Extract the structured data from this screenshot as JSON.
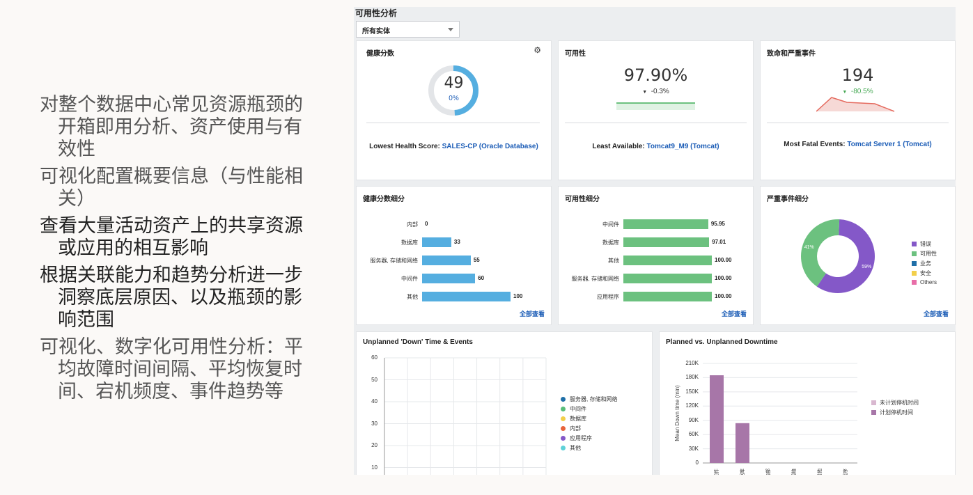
{
  "bullets": [
    {
      "text": "对整个数据中心常见资源瓶颈的开箱即用分析、资产使用与有效性",
      "dark": false
    },
    {
      "text": "可视化配置概要信息（与性能相关）",
      "dark": false
    },
    {
      "text": "查看大量活动资产上的共享资源或应用的相互影响",
      "dark": true
    },
    {
      "text": "根据关联能力和趋势分析进一步洞察底层原因、以及瓶颈的影响范围",
      "dark": true
    },
    {
      "text": "可视化、数字化可用性分析：平均故障时间间隔、平均恢复时间、宕机频度、事件趋势等",
      "dark": false
    }
  ],
  "dashboard": {
    "title": "可用性分析",
    "selector": "所有实体",
    "health": {
      "title": "健康分数",
      "value": "49",
      "percent": "0%",
      "score_fraction": 0.49,
      "footer_label": "Lowest Health Score: ",
      "footer_link": "SALES-CP (Oracle Database)"
    },
    "availability": {
      "title": "可用性",
      "value": "97.90%",
      "delta": "-0.3%",
      "footer_label": "Least Available: ",
      "footer_link": "Tomcat9_M9 (Tomcat)"
    },
    "fatal": {
      "title": "致命和严重事件",
      "value": "194",
      "delta": "-80.5%",
      "footer_label": "Most Fatal Events: ",
      "footer_link": "Tomcat Server 1 (Tomcat)"
    },
    "view_all": "全部查看",
    "unplanned_title": "Unplanned 'Down' Time & Events",
    "planned_title": "Planned vs. Unplanned Downtime"
  },
  "chart_data": [
    {
      "type": "bar",
      "title": "健康分数细分",
      "orientation": "horizontal",
      "categories": [
        "内部",
        "数据库",
        "服务器, 存储和网络",
        "中间件",
        "其他"
      ],
      "values": [
        0,
        33,
        55,
        60,
        100
      ],
      "value_labels": [
        "0",
        "33",
        "55",
        "60",
        "100"
      ],
      "xlim": [
        0,
        100
      ],
      "color": "#55aee0"
    },
    {
      "type": "bar",
      "title": "可用性细分",
      "orientation": "horizontal",
      "categories": [
        "中间件",
        "数据库",
        "其他",
        "服务器, 存储和网络",
        "应用程序"
      ],
      "values": [
        95.95,
        97.01,
        100.0,
        100.0,
        100.0
      ],
      "value_labels": [
        "95.95",
        "97.01",
        "100.00",
        "100.00",
        "100.00"
      ],
      "xlim": [
        0,
        100
      ],
      "color": "#6cc17f"
    },
    {
      "type": "pie",
      "title": "严重事件细分",
      "slices": [
        {
          "name": "错误",
          "value": 59,
          "label": "59%",
          "color": "#8458c8"
        },
        {
          "name": "可用性",
          "value": 41,
          "label": "41%",
          "color": "#6cc17f"
        },
        {
          "name": "业务",
          "value": 0,
          "label": "",
          "color": "#1f6fa8"
        },
        {
          "name": "安全",
          "value": 0,
          "label": "",
          "color": "#f2cf4a"
        },
        {
          "name": "Others",
          "value": 0,
          "label": "",
          "color": "#e86ea8"
        }
      ],
      "legend": "right"
    },
    {
      "type": "line",
      "title": "Unplanned 'Down' Time & Events",
      "y_ticks": [
        "60",
        "50",
        "40",
        "30",
        "20",
        "10"
      ],
      "ylim": [
        0,
        60
      ],
      "series": [
        {
          "name": "服务器, 存储和网络",
          "color": "#1f6fa8"
        },
        {
          "name": "中间件",
          "color": "#58bd7a"
        },
        {
          "name": "数据库",
          "color": "#f2cf4a"
        },
        {
          "name": "内部",
          "color": "#e8633a"
        },
        {
          "name": "应用程序",
          "color": "#8458c8"
        },
        {
          "name": "其他",
          "color": "#5fd1d8"
        }
      ],
      "legend": "right"
    },
    {
      "type": "bar",
      "title": "Planned vs. Unplanned Downtime",
      "ylabel": "Mean Down time (min)",
      "y_ticks": [
        "210K",
        "180K",
        "150K",
        "120K",
        "90K",
        "60K",
        "30K",
        "0"
      ],
      "ylim": [
        0,
        210000
      ],
      "categories": [
        "中间件",
        "数据库",
        "内部",
        "服务器, 存储和网络",
        "其他",
        "应用程序"
      ],
      "x_labels": [
        "中间件",
        "数据库",
        "内部",
        "服务器,存储和网络",
        "其他",
        "应用程序"
      ],
      "series": [
        {
          "name": "未计划停机时间",
          "color": "#d9b8d0",
          "values": [
            0,
            0,
            0,
            0,
            0,
            0
          ]
        },
        {
          "name": "计划停机时间",
          "color": "#a776a8",
          "values": [
            185000,
            84000,
            0,
            0,
            0,
            0
          ]
        }
      ],
      "legend": "right"
    }
  ]
}
